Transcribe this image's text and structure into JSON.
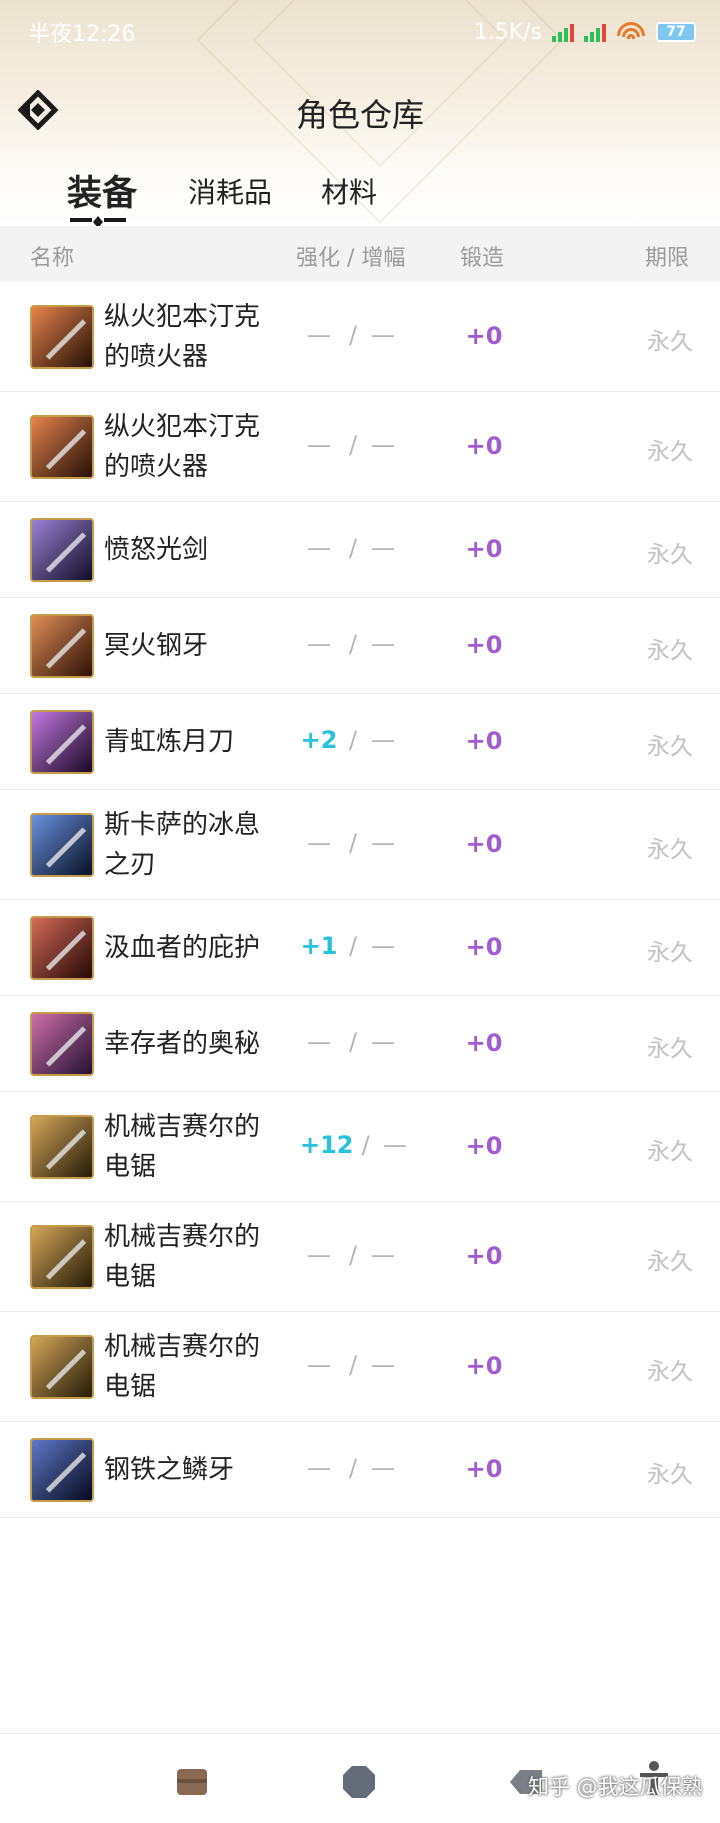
{
  "status_bar": {
    "time": "半夜12:26",
    "net_speed": "1.5K/s",
    "battery": "77"
  },
  "header": {
    "title": "角色仓库"
  },
  "tabs": [
    {
      "label": "装备",
      "active": true
    },
    {
      "label": "消耗品",
      "active": false
    },
    {
      "label": "材料",
      "active": false
    }
  ],
  "columns": {
    "name": "名称",
    "enhance": "强化 / 增幅",
    "forge": "锻造",
    "term": "期限"
  },
  "items": [
    {
      "name": "纵火犯本汀克的喷火器",
      "enhance": "—",
      "amplify": "—",
      "forge": "+0",
      "term": "永久",
      "icon": "flamethrower-icon",
      "colors": [
        "#e05a12",
        "#3a1a08"
      ]
    },
    {
      "name": "纵火犯本汀克的喷火器",
      "enhance": "—",
      "amplify": "—",
      "forge": "+0",
      "term": "永久",
      "icon": "flamethrower-icon",
      "colors": [
        "#e05a12",
        "#3a1a08"
      ]
    },
    {
      "name": "愤怒光剑",
      "enhance": "—",
      "amplify": "—",
      "forge": "+0",
      "term": "永久",
      "icon": "lightsaber-icon",
      "colors": [
        "#7a58c8",
        "#1d1540"
      ]
    },
    {
      "name": "冥火钢牙",
      "enhance": "—",
      "amplify": "—",
      "forge": "+0",
      "term": "永久",
      "icon": "fang-icon",
      "colors": [
        "#d66a1e",
        "#4a1a0a"
      ]
    },
    {
      "name": "青虹炼月刀",
      "enhance": "+2",
      "amplify": "—",
      "forge": "+0",
      "term": "永久",
      "icon": "moon-blade-icon",
      "colors": [
        "#b04ad8",
        "#2a0f3a"
      ]
    },
    {
      "name": "斯卡萨的冰息之刃",
      "enhance": "—",
      "amplify": "—",
      "forge": "+0",
      "term": "永久",
      "icon": "ice-blade-icon",
      "colors": [
        "#3a6ed8",
        "#0c1a3a"
      ]
    },
    {
      "name": "汲血者的庇护",
      "enhance": "+1",
      "amplify": "—",
      "forge": "+0",
      "term": "永久",
      "icon": "blood-shield-icon",
      "colors": [
        "#c83a20",
        "#3a0c08"
      ]
    },
    {
      "name": "幸存者的奥秘",
      "enhance": "—",
      "amplify": "—",
      "forge": "+0",
      "term": "永久",
      "icon": "survivor-icon",
      "colors": [
        "#c0408a",
        "#3a1a50"
      ]
    },
    {
      "name": "机械吉赛尔的电锯",
      "enhance": "+12",
      "amplify": "—",
      "forge": "+0",
      "term": "永久",
      "icon": "chainsaw-icon",
      "colors": [
        "#c88a20",
        "#3a2a0c"
      ]
    },
    {
      "name": "机械吉赛尔的电锯",
      "enhance": "—",
      "amplify": "—",
      "forge": "+0",
      "term": "永久",
      "icon": "chainsaw-icon",
      "colors": [
        "#c88a20",
        "#3a2a0c"
      ]
    },
    {
      "name": "机械吉赛尔的电锯",
      "enhance": "—",
      "amplify": "—",
      "forge": "+0",
      "term": "永久",
      "icon": "chainsaw-icon",
      "colors": [
        "#c88a20",
        "#3a2a0c"
      ]
    },
    {
      "name": "钢铁之鳞牙",
      "enhance": "—",
      "amplify": "—",
      "forge": "+0",
      "term": "永久",
      "icon": "steel-fang-icon",
      "colors": [
        "#2a4ab8",
        "#0a1030"
      ]
    }
  ],
  "bottom_nav": {
    "icons": [
      "box-icon",
      "octagon-icon",
      "tag-icon",
      "person-icon"
    ],
    "watermark": "知乎 @我这瓜保熟"
  }
}
